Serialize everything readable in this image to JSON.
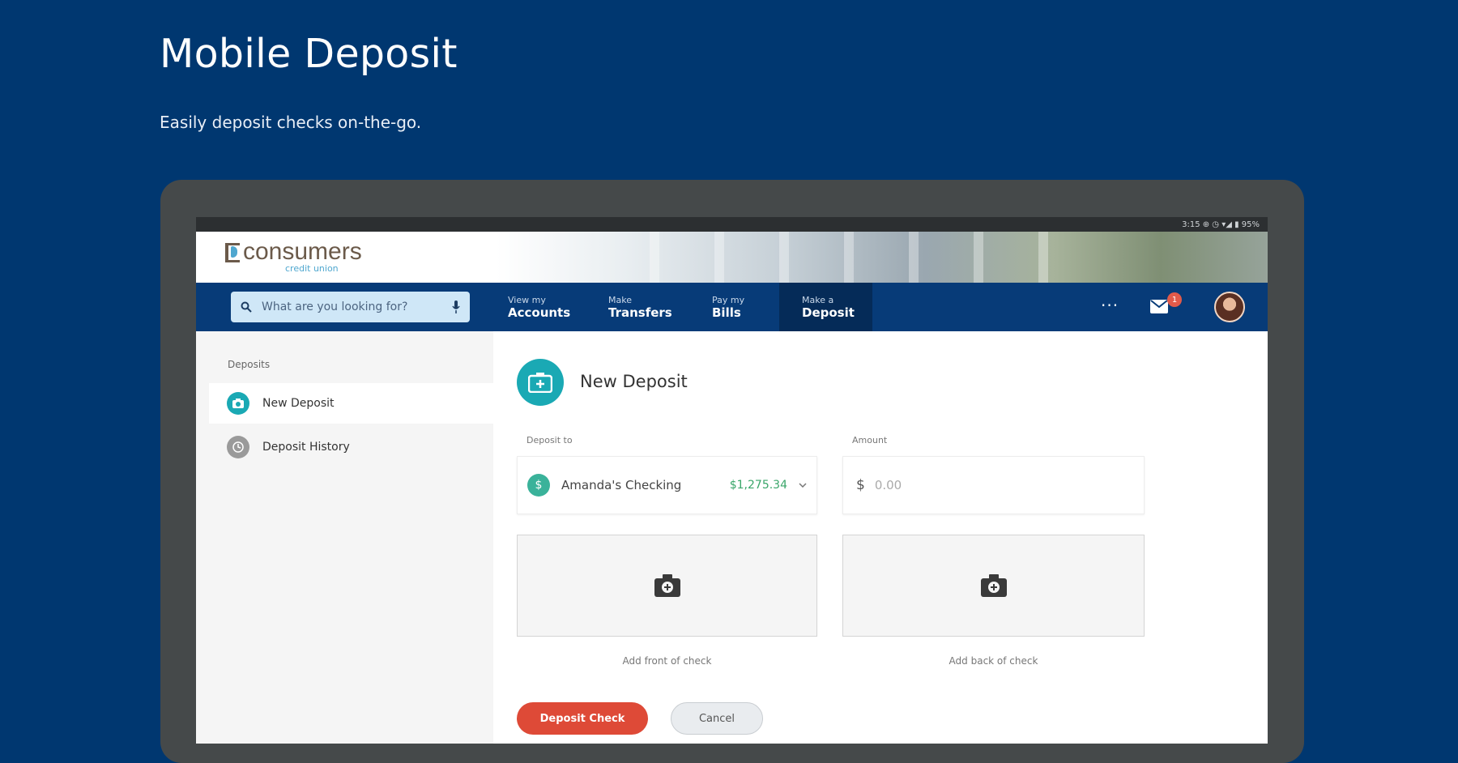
{
  "hero": {
    "title": "Mobile Deposit",
    "subtitle": "Easily deposit checks on-the-go."
  },
  "status_bar": {
    "text": "3:15  ⊕ ◷ ▾◢ ▮ 95%"
  },
  "brand": {
    "name": "consumers",
    "tagline": "credit union"
  },
  "search": {
    "placeholder": "What are you looking for?"
  },
  "nav": {
    "items": [
      {
        "small": "View my",
        "big": "Accounts"
      },
      {
        "small": "Make",
        "big": "Transfers"
      },
      {
        "small": "Pay my",
        "big": "Bills"
      },
      {
        "small": "Make a",
        "big": "Deposit"
      }
    ],
    "active_index": 3,
    "messages_badge": "1"
  },
  "sidebar": {
    "heading": "Deposits",
    "items": [
      {
        "label": "New Deposit",
        "icon": "camera-icon",
        "active": true
      },
      {
        "label": "Deposit History",
        "icon": "history-icon",
        "active": false
      }
    ]
  },
  "form": {
    "title": "New Deposit",
    "deposit_to_label": "Deposit to",
    "account_name": "Amanda's Checking",
    "account_balance": "$1,275.34",
    "amount_label": "Amount",
    "currency_symbol": "$",
    "amount_placeholder": "0.00",
    "front_caption": "Add front of check",
    "back_caption": "Add back of check",
    "submit_label": "Deposit Check",
    "cancel_label": "Cancel"
  },
  "colors": {
    "page_bg": "#003770",
    "nav_bg": "#073b78",
    "accent_teal": "#1aa9b4",
    "primary_button": "#de4a37",
    "balance_green": "#3aa66a"
  }
}
